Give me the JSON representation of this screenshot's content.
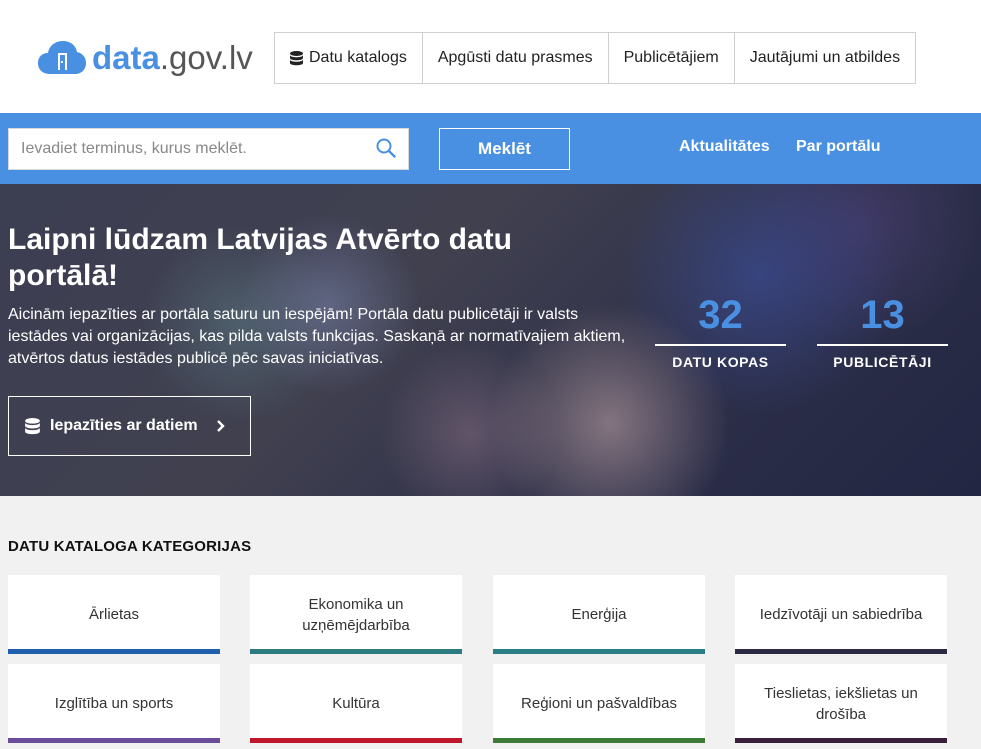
{
  "logo": {
    "data": "data",
    "rest": ".gov.lv"
  },
  "topnav": [
    {
      "label": "Datu katalogs",
      "icon": "database-icon"
    },
    {
      "label": "Apgūsti datu prasmes"
    },
    {
      "label": "Publicētājiem"
    },
    {
      "label": "Jautājumi un atbildes"
    }
  ],
  "search": {
    "placeholder": "Ievadiet terminus, kurus meklēt.",
    "button": "Meklēt"
  },
  "sublinks": [
    "Aktualitātes",
    "Par portālu"
  ],
  "hero": {
    "title": "Laipni lūdzam Latvijas Atvērto datu portālā!",
    "text": "Aicinām iepazīties ar portāla saturu un iespējām! Portāla datu publicētāji ir valsts iestādes vai organizācijas, kas pilda valsts funkcijas. Saskaņā ar normatīvajiem aktiem, atvērtos datus iestādes publicē pēc savas iniciatīvas.",
    "button": "Iepazīties ar datiem",
    "stats": [
      {
        "value": "32",
        "label": "DATU KOPAS"
      },
      {
        "value": "13",
        "label": "PUBLICĒTĀJI"
      }
    ]
  },
  "categories": {
    "title": "DATU KATALOGA KATEGORIJAS",
    "items": [
      {
        "label": "Ārlietas",
        "color": "#1f5fad"
      },
      {
        "label": "Ekonomika un uzņēmējdarbība",
        "color": "#2b7b80"
      },
      {
        "label": "Enerģija",
        "color": "#2a7f86"
      },
      {
        "label": "Iedzīvotāji un sabiedrība",
        "color": "#2a2a44"
      },
      {
        "label": "Izglītība un sports",
        "color": "#6a4d9a"
      },
      {
        "label": "Kultūra",
        "color": "#c0162c"
      },
      {
        "label": "Reģioni un pašvaldības",
        "color": "#3d7a36"
      },
      {
        "label": "Tieslietas, iekšlietas un drošība",
        "color": "#3a1f3a"
      }
    ]
  },
  "colors": {
    "accent": "#4a90e2"
  }
}
